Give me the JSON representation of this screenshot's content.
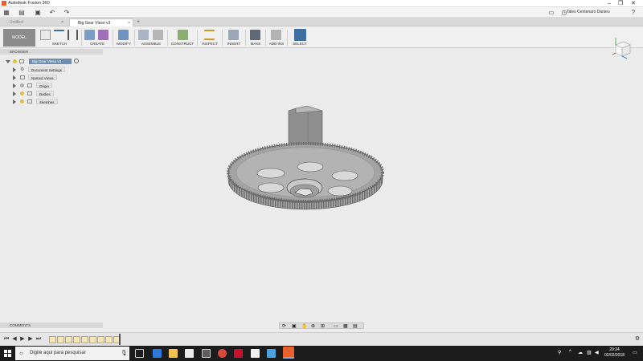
{
  "window": {
    "title": "Autodesk Fusion 360"
  },
  "quick_access": {
    "user_name": "Tales Centenaro Danieu"
  },
  "tabs": [
    {
      "label": "Untitled"
    },
    {
      "label": "Big Gear Vleso v3"
    }
  ],
  "ribbon": {
    "workspace": "MODEL",
    "groups": [
      {
        "label": "SKETCH"
      },
      {
        "label": "CREATE"
      },
      {
        "label": "MODIFY"
      },
      {
        "label": "ASSEMBLE"
      },
      {
        "label": "CONSTRUCT"
      },
      {
        "label": "INSPECT"
      },
      {
        "label": "INSERT"
      },
      {
        "label": "MAKE"
      },
      {
        "label": "ADD-INS"
      },
      {
        "label": "SELECT"
      }
    ]
  },
  "browser": {
    "title": "BROWSER",
    "root": "Big Gear Vleso v3",
    "items": [
      {
        "label": "Document Settings",
        "icon": "gear-icon"
      },
      {
        "label": "Named Views",
        "icon": "folder-icon"
      },
      {
        "label": "Origin",
        "icon": "folder-icon"
      },
      {
        "label": "Bodies",
        "icon": "folder-icon"
      },
      {
        "label": "Sketches",
        "icon": "folder-icon"
      }
    ]
  },
  "comments": {
    "title": "COMMENTS"
  },
  "taskbar": {
    "search_placeholder": "Digite aqui para pesquisar",
    "time": "20:24",
    "date": "02/02/2018"
  },
  "colors": {
    "accent": "#3f6fa0",
    "brand": "#e8612c",
    "gear": "#8f8f8f"
  }
}
